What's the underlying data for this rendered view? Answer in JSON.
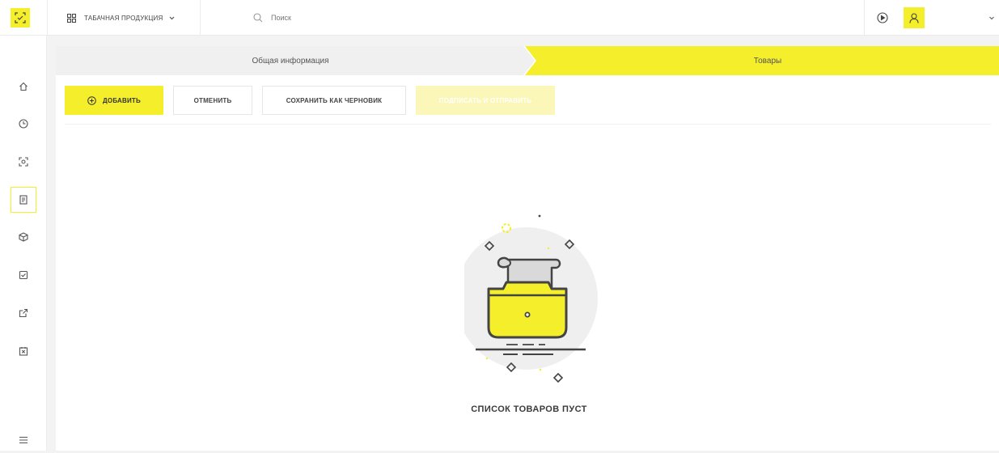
{
  "header": {
    "product_category": "ТАБАЧНАЯ ПРОДУКЦИЯ",
    "search_placeholder": "Поиск"
  },
  "icons": {
    "logo": "logo-icon",
    "apps": "apps-grid-icon",
    "search": "search-icon",
    "play": "play-circle-icon",
    "user": "user-icon",
    "chevron": "chevron-down-icon"
  },
  "sidebar": {
    "items": [
      {
        "icon": "home-icon"
      },
      {
        "icon": "clock-icon"
      },
      {
        "icon": "scan-icon"
      },
      {
        "icon": "documents-icon",
        "active": true
      },
      {
        "icon": "box-icon"
      },
      {
        "icon": "checklist-icon"
      },
      {
        "icon": "export-icon"
      },
      {
        "icon": "writeoff-icon"
      },
      {
        "icon": "menu-icon"
      }
    ]
  },
  "steps": [
    {
      "label": "Общая информация",
      "active": false
    },
    {
      "label": "Товары",
      "active": true
    }
  ],
  "toolbar": {
    "add_label": "ДОБАВИТЬ",
    "cancel_label": "ОТМЕНИТЬ",
    "save_draft_label": "СОХРАНИТЬ КАК ЧЕРНОВИК",
    "sign_send_label": "ПОДПИСАТЬ И ОТПРАВИТЬ"
  },
  "empty_state": {
    "title": "СПИСОК ТОВАРОВ ПУСТ"
  },
  "colors": {
    "accent": "#f5ee2a",
    "accent_disabled": "#faf7b8",
    "step_inactive": "#f0f0f0",
    "background": "#f3f3f3"
  }
}
